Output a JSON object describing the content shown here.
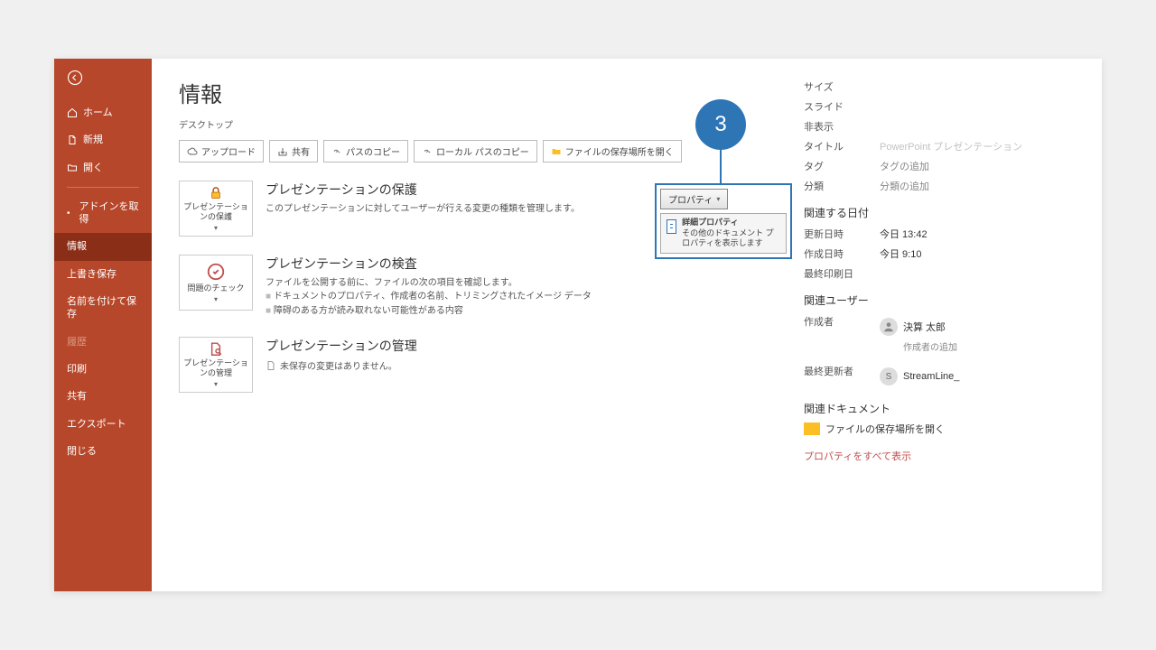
{
  "step_number": "3",
  "sidebar": {
    "home": "ホーム",
    "new": "新規",
    "open": "開く",
    "addin": "アドインを取得",
    "info": "情報",
    "save": "上書き保存",
    "saveas": "名前を付けて保存",
    "history": "履歴",
    "print": "印刷",
    "share": "共有",
    "export": "エクスポート",
    "close": "閉じる"
  },
  "page": {
    "title": "情報",
    "location": "デスクトップ"
  },
  "buttons": {
    "upload": "アップロード",
    "share": "共有",
    "copypath": "パスのコピー",
    "copylocal": "ローカル パスのコピー",
    "openloc": "ファイルの保存場所を開く"
  },
  "sections": {
    "protect": {
      "title": "プレゼンテーションの保護",
      "desc": "このプレゼンテーションに対してユーザーが行える変更の種類を管理します。",
      "tile": "プレゼンテーションの保護"
    },
    "inspect": {
      "title": "プレゼンテーションの検査",
      "desc": "ファイルを公開する前に、ファイルの次の項目を確認します。",
      "b1": "ドキュメントのプロパティ、作成者の名前、トリミングされたイメージ データ",
      "b2": "障碍のある方が読み取れない可能性がある内容",
      "tile": "問題のチェック"
    },
    "manage": {
      "title": "プレゼンテーションの管理",
      "none": "未保存の変更はありません。",
      "tile": "プレゼンテーションの管理"
    }
  },
  "props": {
    "properties_btn": "プロパティ",
    "dd_title": "詳細プロパティ",
    "dd_desc": "その他のドキュメント プロパティを表示します",
    "labels": {
      "properties": "プロパティ",
      "size": "サイズ",
      "slides": "スライド",
      "hidden": "非表示",
      "title": "タイトル",
      "tags": "タグ",
      "category": "分類",
      "dates": "関連する日付",
      "modified": "更新日時",
      "created": "作成日時",
      "printed": "最終印刷日",
      "users": "関連ユーザー",
      "author": "作成者",
      "lastmod": "最終更新者",
      "docs": "関連ドキュメント",
      "openloc2": "ファイルの保存場所を開く",
      "showall": "プロパティをすべて表示",
      "addauthor": "作成者の追加"
    },
    "vals": {
      "title": "PowerPoint プレゼンテーション",
      "tags": "タグの追加",
      "category": "分類の追加",
      "modified": "今日 13:42",
      "created": "今日 9:10",
      "author_name": "決算 太郎",
      "lastmod_name": "StreamLine_",
      "lastmod_initial": "S"
    }
  }
}
